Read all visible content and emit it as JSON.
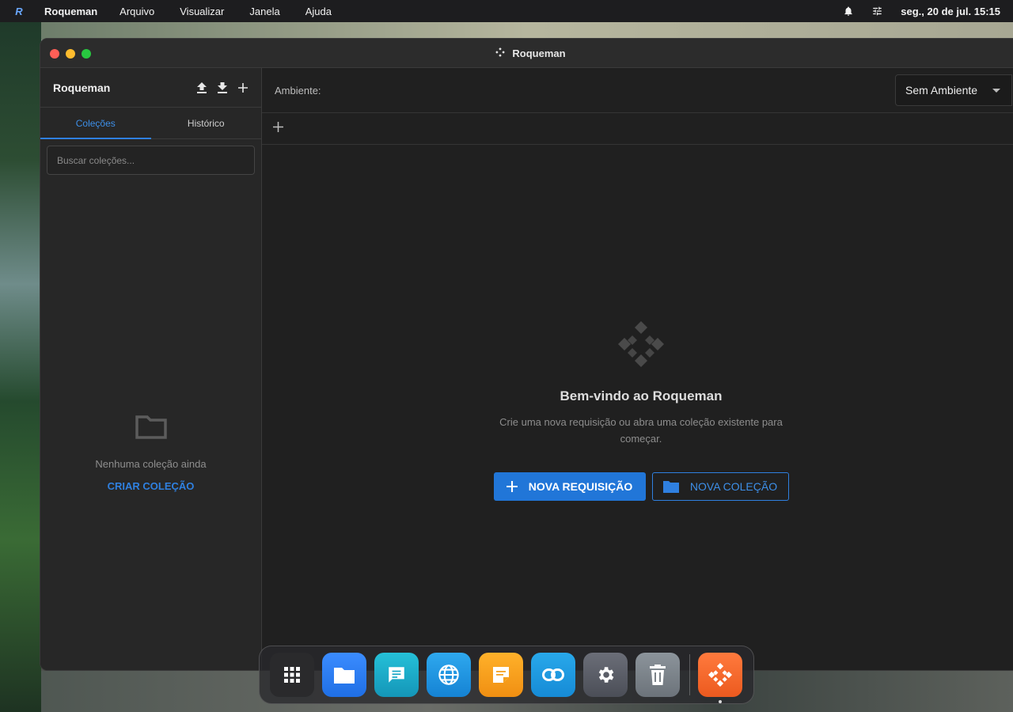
{
  "menubar": {
    "app_name": "Roqueman",
    "menus": [
      "Arquivo",
      "Visualizar",
      "Janela",
      "Ajuda"
    ],
    "clock": "seg., 20 de jul. 15:15",
    "icons": [
      "bell-icon",
      "sliders-icon"
    ]
  },
  "window": {
    "title": "Roqueman"
  },
  "sidebar": {
    "title": "Roqueman",
    "actions": [
      "upload-icon",
      "download-icon",
      "plus-icon"
    ],
    "tabs": [
      {
        "label": "Coleções",
        "active": true
      },
      {
        "label": "Histórico",
        "active": false
      }
    ],
    "search_placeholder": "Buscar coleções...",
    "empty_text": "Nenhuma coleção ainda",
    "create_link": "CRIAR COLEÇÃO"
  },
  "main": {
    "env_label": "Ambiente:",
    "env_value": "Sem Ambiente",
    "welcome_title": "Bem-vindo ao Roqueman",
    "welcome_sub": "Crie uma nova requisição ou abra uma coleção existente para começar.",
    "btn_new_request": "NOVA REQUISIÇÃO",
    "btn_new_collection": "NOVA COLEÇÃO"
  },
  "dock": {
    "items": [
      "app-grid-icon",
      "files-icon",
      "chat-icon",
      "browser-icon",
      "notes-icon",
      "link-icon",
      "settings-icon",
      "trash-icon",
      "roqueman-icon"
    ]
  },
  "colors": {
    "accent": "#2176d8",
    "accent_link": "#2f80e0",
    "window_bg": "#202020",
    "sidebar_bg": "#272727"
  }
}
